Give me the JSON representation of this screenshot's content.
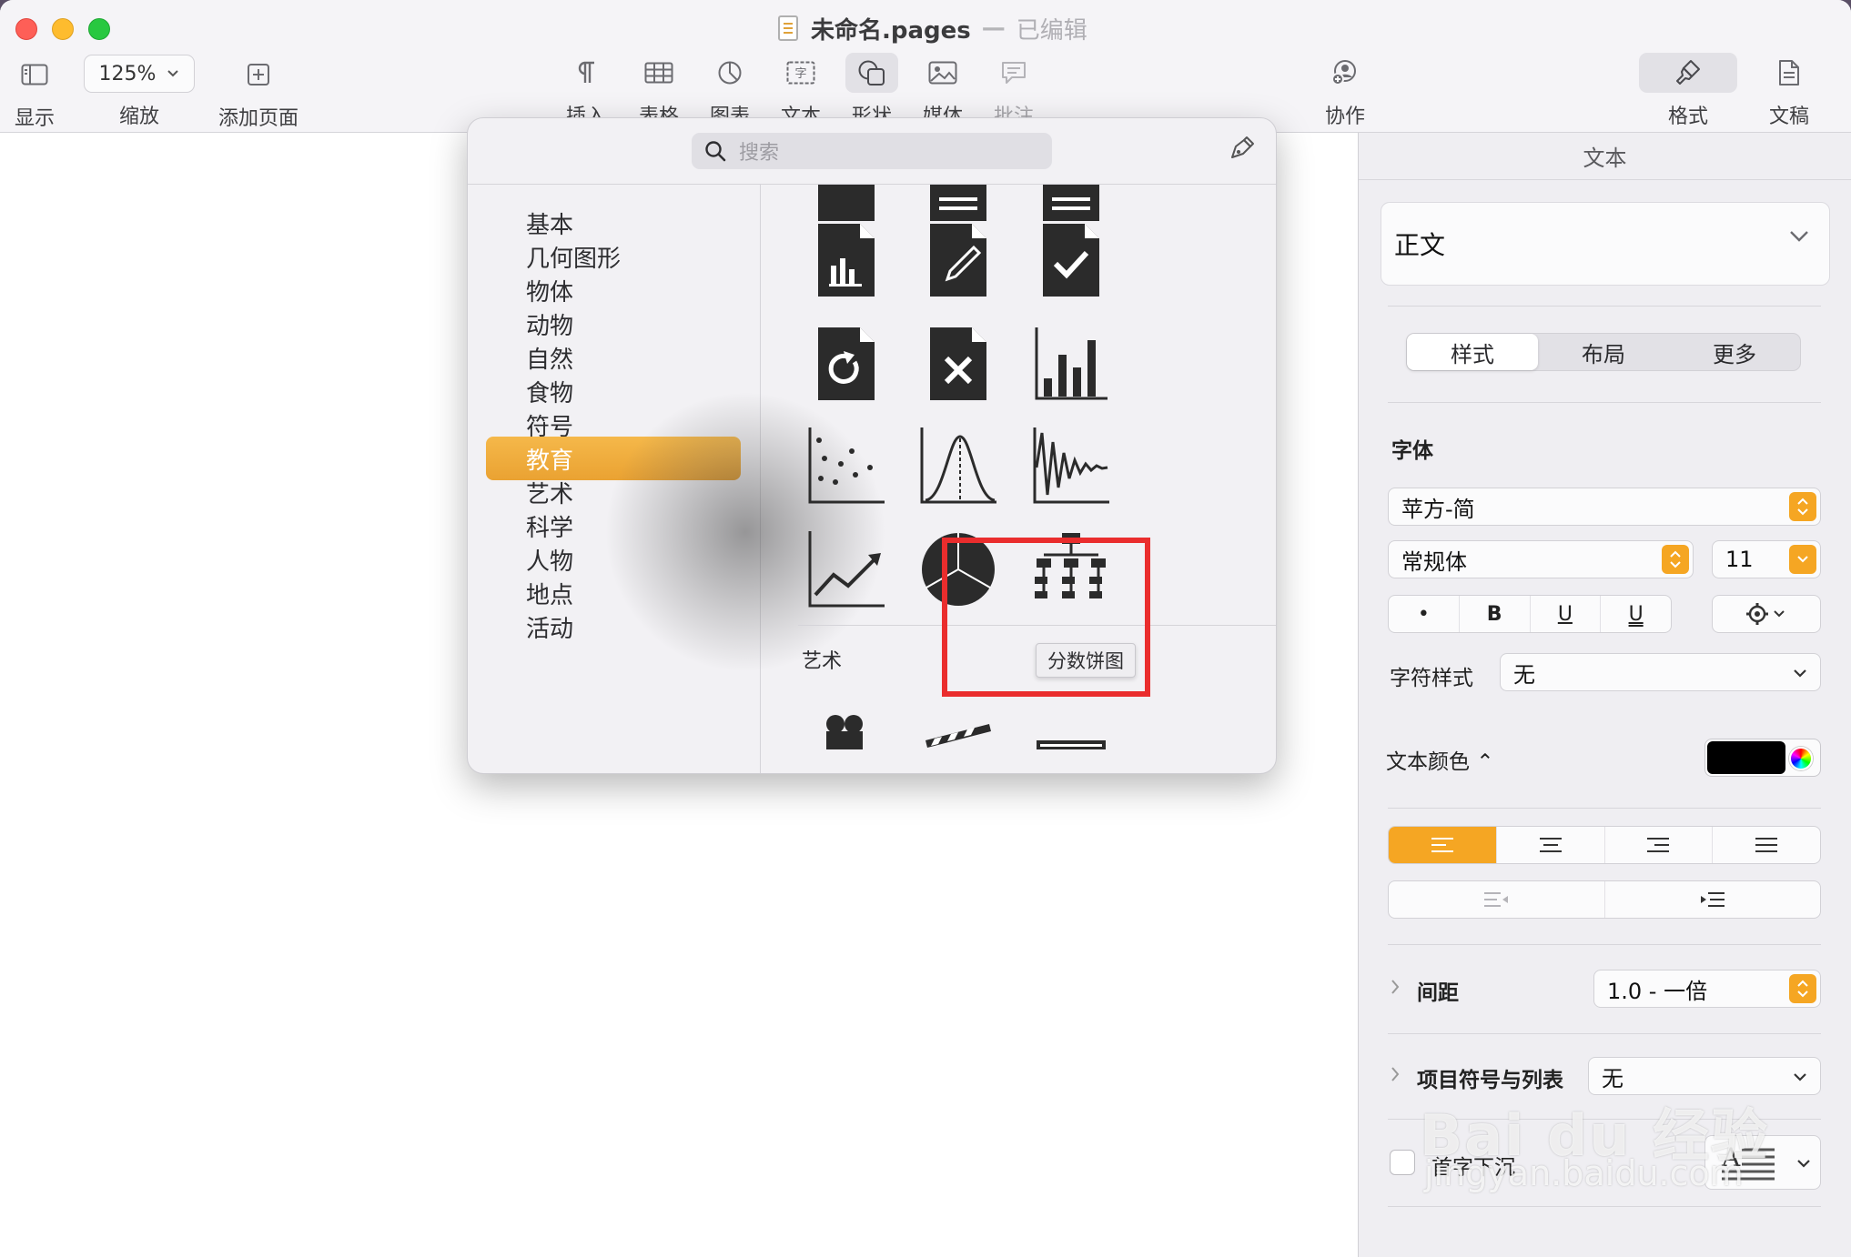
{
  "window": {
    "doc_name": "未命名.pages",
    "separator": "—",
    "status": "已编辑"
  },
  "toolbar": {
    "view": "显示",
    "zoom_value": "125%",
    "zoom": "缩放",
    "add_page": "添加页面",
    "insert": "插入",
    "table": "表格",
    "chart": "图表",
    "text": "文本",
    "shape": "形状",
    "media": "媒体",
    "comment": "批注",
    "collaborate": "协作",
    "format": "格式",
    "document": "文稿"
  },
  "popover": {
    "search_placeholder": "搜索",
    "categories": [
      "基本",
      "几何图形",
      "物体",
      "动物",
      "自然",
      "食物",
      "符号",
      "教育",
      "艺术",
      "科学",
      "人物",
      "地点",
      "活动"
    ],
    "selected_category": "教育",
    "next_section": "艺术",
    "tooltip": "分数饼图"
  },
  "panel": {
    "title": "文本",
    "paragraph_style": "正文",
    "tabs": [
      "样式",
      "布局",
      "更多"
    ],
    "font_section": "字体",
    "font_family": "苹方-简",
    "font_typeface": "常规体",
    "font_size": "11",
    "format_buttons": [
      "•",
      "B",
      "U",
      "U"
    ],
    "char_style_label": "字符样式",
    "char_style_value": "无",
    "text_color_label": "文本颜色 ⌃",
    "text_color": "#000000",
    "spacing_label": "间距",
    "spacing_value": "1.0 - 一倍",
    "bullets_label": "项目符号与列表",
    "bullets_value": "无",
    "dropcap_label": "首字下沉"
  },
  "watermark": {
    "main": "Bai du 经验",
    "sub": "jingyan.baidu.com"
  },
  "colors": {
    "accent": "#f5a623",
    "highlight": "#ea2d2d"
  }
}
